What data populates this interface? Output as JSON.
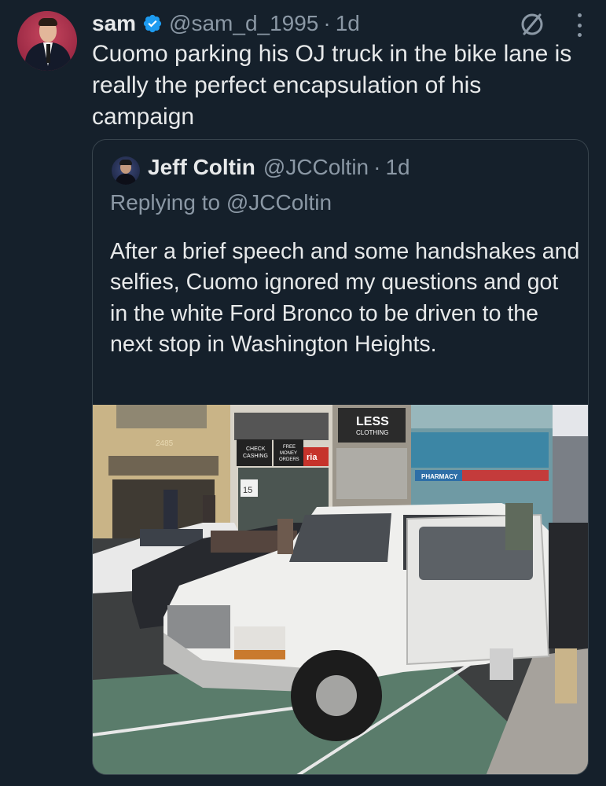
{
  "tweet": {
    "author_name": "sam",
    "author_handle": "@sam_d_1995",
    "separator": "·",
    "age": "1d",
    "text": "Cuomo parking his OJ truck in the bike lane is really the perfect encapsulation of his campaign"
  },
  "quoted": {
    "author_name": "Jeff Coltin",
    "author_handle": "@JCColtin",
    "separator": "·",
    "age": "1d",
    "replying_to": "Replying to @JCColtin",
    "text": "After a brief speech and some handshakes and selfies, Cuomo ignored my questions and got in the white Ford Bronco to be driven to the next stop in Washington Heights."
  },
  "photo_signs": {
    "less": "LESS",
    "clothing": "CLOTHING",
    "check": "CHECK",
    "cashing": "CASHING",
    "free": "FREE",
    "money": "MONEY",
    "orders": "ORDERS",
    "ria": "ria",
    "pharmacy": "PHARMACY",
    "building_number": "2485",
    "bus_number": "15"
  },
  "colors": {
    "background": "#15202b",
    "text_primary": "#e7e9ea",
    "text_secondary": "#8b98a5",
    "verified_badge": "#1d9bf0",
    "border": "#38444d"
  },
  "icons": {
    "verified": "verified-badge-icon",
    "grok": "slash-circle-icon",
    "more": "more-vertical-icon"
  }
}
